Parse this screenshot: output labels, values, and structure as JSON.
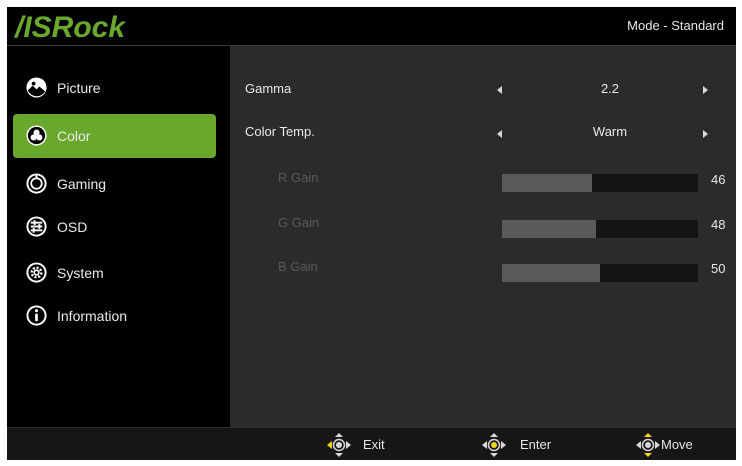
{
  "brand": {
    "logo_text": "/ISRock",
    "accent": "#6aa82d"
  },
  "header": {
    "mode_label": "Mode - Standard"
  },
  "sidebar": {
    "items": [
      {
        "label": "Picture",
        "icon": "picture-icon",
        "active": false
      },
      {
        "label": "Color",
        "icon": "color-icon",
        "active": true
      },
      {
        "label": "Gaming",
        "icon": "gaming-icon",
        "active": false
      },
      {
        "label": "OSD",
        "icon": "osd-icon",
        "active": false
      },
      {
        "label": "System",
        "icon": "system-icon",
        "active": false
      },
      {
        "label": "Information",
        "icon": "information-icon",
        "active": false
      }
    ]
  },
  "color_menu": {
    "gamma": {
      "label": "Gamma",
      "value": "2.2"
    },
    "color_temp": {
      "label": "Color Temp.",
      "value": "Warm"
    },
    "gains": [
      {
        "label": "R Gain",
        "value": "46",
        "level": 46
      },
      {
        "label": "G Gain",
        "value": "48",
        "level": 48
      },
      {
        "label": "B Gain",
        "value": "50",
        "level": 50
      }
    ]
  },
  "footer": {
    "exit_label": "Exit",
    "enter_label": "Enter",
    "move_label": "Move"
  }
}
